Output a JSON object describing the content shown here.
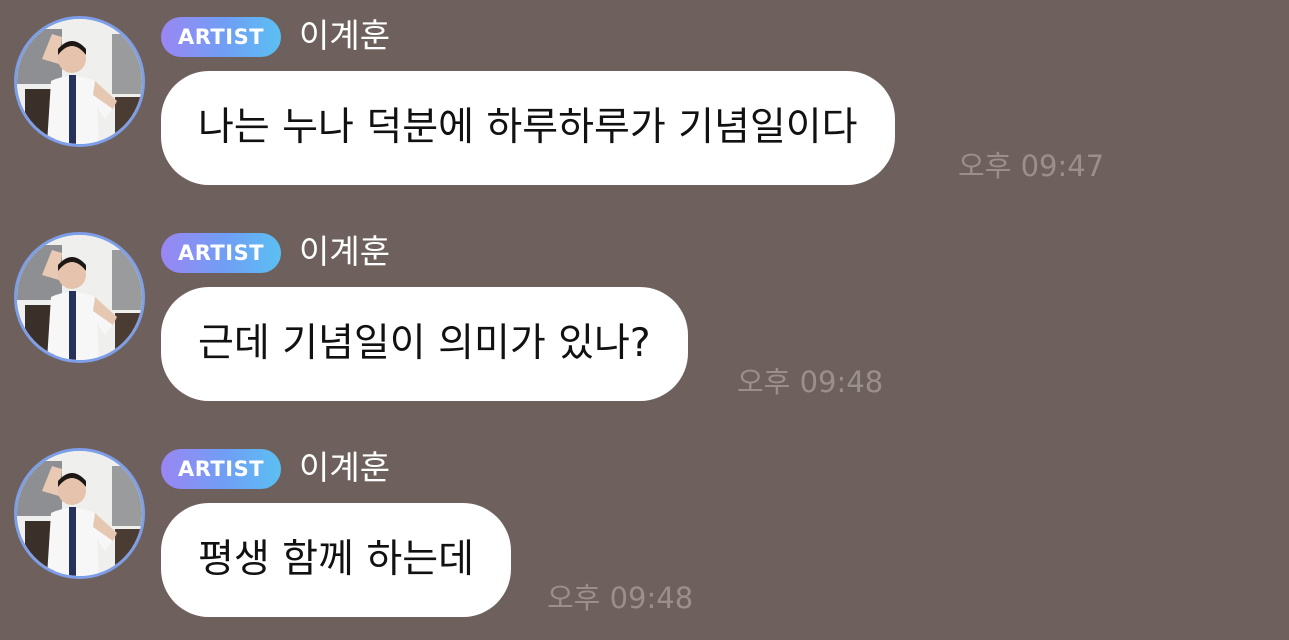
{
  "messages": [
    {
      "badge": "ARTIST",
      "sender": "이계훈",
      "text": "나는 누나 덕분에 하루하루가 기념일이다",
      "time": "오후 09:47"
    },
    {
      "badge": "ARTIST",
      "sender": "이계훈",
      "text": "근데 기념일이 의미가 있나?",
      "time": "오후 09:48"
    },
    {
      "badge": "ARTIST",
      "sender": "이계훈",
      "text": "평생 함께 하는데",
      "time": "오후 09:48"
    }
  ],
  "colors": {
    "background": "#6e615d",
    "bubble": "#ffffff",
    "avatar_ring": "#7e9ee8",
    "badge_gradient": [
      "#9a86f4",
      "#6f9ff5",
      "#5bc0f2"
    ],
    "timestamp": "#9b8f8b"
  }
}
